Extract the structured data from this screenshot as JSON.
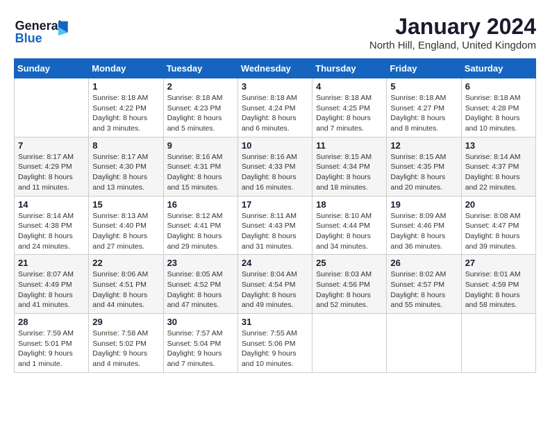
{
  "header": {
    "logo_line1": "General",
    "logo_line2": "Blue",
    "month": "January 2024",
    "location": "North Hill, England, United Kingdom"
  },
  "days_of_week": [
    "Sunday",
    "Monday",
    "Tuesday",
    "Wednesday",
    "Thursday",
    "Friday",
    "Saturday"
  ],
  "weeks": [
    [
      {
        "day": "",
        "info": ""
      },
      {
        "day": "1",
        "info": "Sunrise: 8:18 AM\nSunset: 4:22 PM\nDaylight: 8 hours\nand 3 minutes."
      },
      {
        "day": "2",
        "info": "Sunrise: 8:18 AM\nSunset: 4:23 PM\nDaylight: 8 hours\nand 5 minutes."
      },
      {
        "day": "3",
        "info": "Sunrise: 8:18 AM\nSunset: 4:24 PM\nDaylight: 8 hours\nand 6 minutes."
      },
      {
        "day": "4",
        "info": "Sunrise: 8:18 AM\nSunset: 4:25 PM\nDaylight: 8 hours\nand 7 minutes."
      },
      {
        "day": "5",
        "info": "Sunrise: 8:18 AM\nSunset: 4:27 PM\nDaylight: 8 hours\nand 8 minutes."
      },
      {
        "day": "6",
        "info": "Sunrise: 8:18 AM\nSunset: 4:28 PM\nDaylight: 8 hours\nand 10 minutes."
      }
    ],
    [
      {
        "day": "7",
        "info": "Sunrise: 8:17 AM\nSunset: 4:29 PM\nDaylight: 8 hours\nand 11 minutes."
      },
      {
        "day": "8",
        "info": "Sunrise: 8:17 AM\nSunset: 4:30 PM\nDaylight: 8 hours\nand 13 minutes."
      },
      {
        "day": "9",
        "info": "Sunrise: 8:16 AM\nSunset: 4:31 PM\nDaylight: 8 hours\nand 15 minutes."
      },
      {
        "day": "10",
        "info": "Sunrise: 8:16 AM\nSunset: 4:33 PM\nDaylight: 8 hours\nand 16 minutes."
      },
      {
        "day": "11",
        "info": "Sunrise: 8:15 AM\nSunset: 4:34 PM\nDaylight: 8 hours\nand 18 minutes."
      },
      {
        "day": "12",
        "info": "Sunrise: 8:15 AM\nSunset: 4:35 PM\nDaylight: 8 hours\nand 20 minutes."
      },
      {
        "day": "13",
        "info": "Sunrise: 8:14 AM\nSunset: 4:37 PM\nDaylight: 8 hours\nand 22 minutes."
      }
    ],
    [
      {
        "day": "14",
        "info": "Sunrise: 8:14 AM\nSunset: 4:38 PM\nDaylight: 8 hours\nand 24 minutes."
      },
      {
        "day": "15",
        "info": "Sunrise: 8:13 AM\nSunset: 4:40 PM\nDaylight: 8 hours\nand 27 minutes."
      },
      {
        "day": "16",
        "info": "Sunrise: 8:12 AM\nSunset: 4:41 PM\nDaylight: 8 hours\nand 29 minutes."
      },
      {
        "day": "17",
        "info": "Sunrise: 8:11 AM\nSunset: 4:43 PM\nDaylight: 8 hours\nand 31 minutes."
      },
      {
        "day": "18",
        "info": "Sunrise: 8:10 AM\nSunset: 4:44 PM\nDaylight: 8 hours\nand 34 minutes."
      },
      {
        "day": "19",
        "info": "Sunrise: 8:09 AM\nSunset: 4:46 PM\nDaylight: 8 hours\nand 36 minutes."
      },
      {
        "day": "20",
        "info": "Sunrise: 8:08 AM\nSunset: 4:47 PM\nDaylight: 8 hours\nand 39 minutes."
      }
    ],
    [
      {
        "day": "21",
        "info": "Sunrise: 8:07 AM\nSunset: 4:49 PM\nDaylight: 8 hours\nand 41 minutes."
      },
      {
        "day": "22",
        "info": "Sunrise: 8:06 AM\nSunset: 4:51 PM\nDaylight: 8 hours\nand 44 minutes."
      },
      {
        "day": "23",
        "info": "Sunrise: 8:05 AM\nSunset: 4:52 PM\nDaylight: 8 hours\nand 47 minutes."
      },
      {
        "day": "24",
        "info": "Sunrise: 8:04 AM\nSunset: 4:54 PM\nDaylight: 8 hours\nand 49 minutes."
      },
      {
        "day": "25",
        "info": "Sunrise: 8:03 AM\nSunset: 4:56 PM\nDaylight: 8 hours\nand 52 minutes."
      },
      {
        "day": "26",
        "info": "Sunrise: 8:02 AM\nSunset: 4:57 PM\nDaylight: 8 hours\nand 55 minutes."
      },
      {
        "day": "27",
        "info": "Sunrise: 8:01 AM\nSunset: 4:59 PM\nDaylight: 8 hours\nand 58 minutes."
      }
    ],
    [
      {
        "day": "28",
        "info": "Sunrise: 7:59 AM\nSunset: 5:01 PM\nDaylight: 9 hours\nand 1 minute."
      },
      {
        "day": "29",
        "info": "Sunrise: 7:58 AM\nSunset: 5:02 PM\nDaylight: 9 hours\nand 4 minutes."
      },
      {
        "day": "30",
        "info": "Sunrise: 7:57 AM\nSunset: 5:04 PM\nDaylight: 9 hours\nand 7 minutes."
      },
      {
        "day": "31",
        "info": "Sunrise: 7:55 AM\nSunset: 5:06 PM\nDaylight: 9 hours\nand 10 minutes."
      },
      {
        "day": "",
        "info": ""
      },
      {
        "day": "",
        "info": ""
      },
      {
        "day": "",
        "info": ""
      }
    ]
  ]
}
